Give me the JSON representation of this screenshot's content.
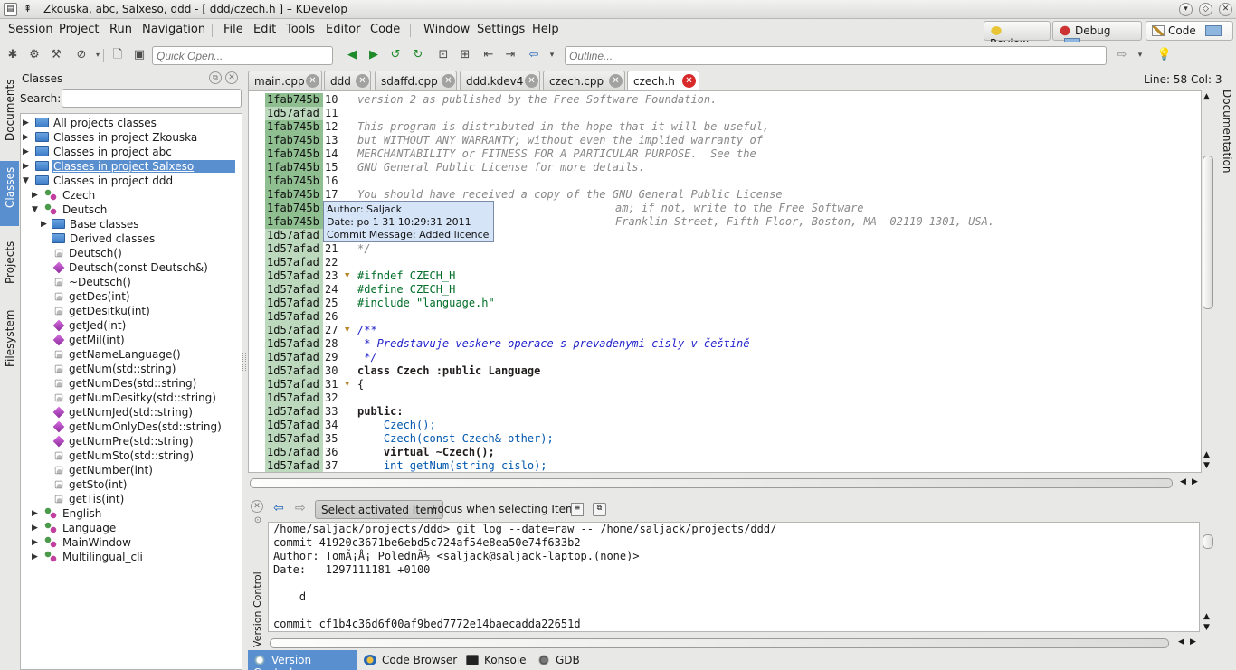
{
  "window": {
    "title": "Zkouska, abc, Salxeso, ddd - [ ddd/czech.h ] – KDevelop"
  },
  "menu": [
    "Session",
    "Project",
    "Run",
    "Navigation",
    "File",
    "Edit",
    "Tools",
    "Editor",
    "Code",
    "Window",
    "Settings",
    "Help"
  ],
  "areas": {
    "review": "Review",
    "debug": "Debug",
    "code": "Code"
  },
  "toolbar": {
    "quick_open_placeholder": "Quick Open...",
    "outline_placeholder": "Outline..."
  },
  "status": {
    "line_col": "Line: 58 Col: 3"
  },
  "left_tabs": [
    "Documents",
    "Classes",
    "Projects",
    "Filesystem"
  ],
  "right_tabs": [
    "Documentation"
  ],
  "classes_panel": {
    "title": "Classes",
    "search_label": "Search:",
    "search_value": "",
    "roots": [
      "All projects classes",
      "Classes in project Zkouska",
      "Classes in project abc",
      "Classes in project Salxeso",
      "Classes in project ddd"
    ],
    "czech": "Czech",
    "deutsch": "Deutsch",
    "base_classes": "Base classes",
    "derived_classes": "Derived classes",
    "methods": [
      "Deutsch()",
      "Deutsch(const Deutsch&)",
      "~Deutsch()",
      "getDes(int)",
      "getDesitku(int)",
      "getJed(int)",
      "getMil(int)",
      "getNameLanguage()",
      "getNum(std::string)",
      "getNumDes(std::string)",
      "getNumDesitky(std::string)",
      "getNumJed(std::string)",
      "getNumOnlyDes(std::string)",
      "getNumPre(std::string)",
      "getNumSto(std::string)",
      "getNumber(int)",
      "getSto(int)",
      "getTis(int)"
    ],
    "other_classes": [
      "English",
      "Language",
      "MainWindow",
      "Multilingual_cli"
    ]
  },
  "editor_tabs": [
    "main.cpp",
    "ddd",
    "sdaffd.cpp",
    "ddd.kdev4",
    "czech.cpp",
    "czech.h"
  ],
  "editor": {
    "lines": [
      {
        "commit": "1fab745b",
        "num": "10",
        "text": "version 2 as published by the Free Software Foundation."
      },
      {
        "commit": "1d57afad",
        "num": "11",
        "text": ""
      },
      {
        "commit": "1fab745b",
        "num": "12",
        "text": "This program is distributed in the hope that it will be useful,"
      },
      {
        "commit": "1fab745b",
        "num": "13",
        "text": "but WITHOUT ANY WARRANTY; without even the implied warranty of"
      },
      {
        "commit": "1fab745b",
        "num": "14",
        "text": "MERCHANTABILITY or FITNESS FOR A PARTICULAR PURPOSE.  See the"
      },
      {
        "commit": "1fab745b",
        "num": "15",
        "text": "GNU General Public License for more details."
      },
      {
        "commit": "1fab745b",
        "num": "16",
        "text": ""
      },
      {
        "commit": "1fab745b",
        "num": "17",
        "text": "You should have received a copy of the GNU General Public License"
      },
      {
        "commit": "1fab745b",
        "num": "18",
        "text": "am; if not, write to the Free Software"
      },
      {
        "commit": "1fab745b",
        "num": "19",
        "text": "Franklin Street, Fifth Floor, Boston, MA  02110-1301, USA."
      },
      {
        "commit": "1d57afad",
        "num": "20",
        "text": ""
      },
      {
        "commit": "1d57afad",
        "num": "21",
        "text": "*/"
      },
      {
        "commit": "1d57afad",
        "num": "22",
        "text": ""
      },
      {
        "commit": "1d57afad",
        "num": "23",
        "text": "#ifndef CZECH_H"
      },
      {
        "commit": "1d57afad",
        "num": "24",
        "text": "#define CZECH_H"
      },
      {
        "commit": "1d57afad",
        "num": "25",
        "text": "#include \"language.h\""
      },
      {
        "commit": "1d57afad",
        "num": "26",
        "text": ""
      },
      {
        "commit": "1d57afad",
        "num": "27",
        "text": "/**"
      },
      {
        "commit": "1d57afad",
        "num": "28",
        "text": " * Predstavuje veskere operace s prevadenymi cisly v češtině"
      },
      {
        "commit": "1d57afad",
        "num": "29",
        "text": " */"
      },
      {
        "commit": "1d57afad",
        "num": "30",
        "text": "class Czech :public Language"
      },
      {
        "commit": "1d57afad",
        "num": "31",
        "text": "{"
      },
      {
        "commit": "1d57afad",
        "num": "32",
        "text": ""
      },
      {
        "commit": "1d57afad",
        "num": "33",
        "text": "public:"
      },
      {
        "commit": "1d57afad",
        "num": "34",
        "text": "    Czech();"
      },
      {
        "commit": "1d57afad",
        "num": "35",
        "text": "    Czech(const Czech& other);"
      },
      {
        "commit": "1d57afad",
        "num": "36",
        "text": "    virtual ~Czech();"
      },
      {
        "commit": "1d57afad",
        "num": "37",
        "text": "    int getNum(string cislo);"
      }
    ],
    "tooltip": {
      "author": "Author: Saljack",
      "date": "Date: po 1 31 10:29:31 2011",
      "message": "Commit Message: Added licence"
    }
  },
  "version_control": {
    "select_activated": "Select activated Item",
    "focus_when_selecting": "Focus when selecting Item",
    "side_label": "Version Control",
    "output": [
      "/home/saljack/projects/ddd> git log --date=raw -- /home/saljack/projects/ddd/",
      "commit 41920c3671be6ebd5c724af54e8ea50e74f633b2",
      "Author: TomÃ¡Å¡ PolednÃ½ <saljack@saljack-laptop.(none)>",
      "Date:   1297111181 +0100",
      "",
      "    d",
      "",
      "commit cf1b4c36d6f00af9bed7772e14baecadda22651d"
    ]
  },
  "bottom_tabs": [
    "Version Control",
    "Code Browser",
    "Konsole",
    "GDB"
  ]
}
